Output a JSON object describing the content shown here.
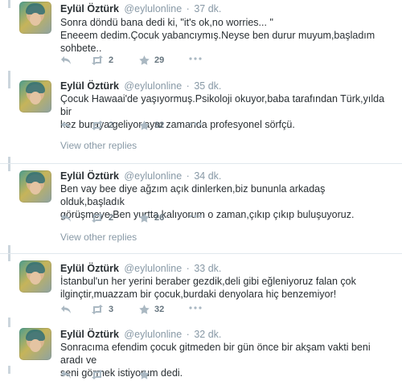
{
  "tweets": [
    {
      "name": "Eylül Öztürk",
      "handle": "@eylulonline",
      "time": "37 dk.",
      "text_lines": [
        "Sonra döndü bana dedi ki, \"it's ok,no worries... \"",
        "Eneeem dedim.Çocuk yabancıymış.Neyse ben durur muyum,başladım",
        "sohbete.."
      ],
      "retweets": "2",
      "favorites": "29"
    },
    {
      "name": "Eylül Öztürk",
      "handle": "@eylulonline",
      "time": "35 dk.",
      "text_lines": [
        "Çocuk Hawaai'de yaşıyormuş.Psikoloji okuyor,baba tarafından Türk,yılda bir",
        "kez buraya geliyor,aynı zamanda profesyonel sörfçü."
      ],
      "retweets": "2",
      "favorites": "32",
      "view_replies": "View other replies"
    },
    {
      "name": "Eylül Öztürk",
      "handle": "@eylulonline",
      "time": "34 dk.",
      "text_lines": [
        "Ben vay bee diye ağzım açık dinlerken,biz bununla arkadaş olduk,başladık",
        "görüşmeye.Ben yurtta kalıyorum o zaman,çıkıp çıkıp buluşuyoruz."
      ],
      "retweets": "2",
      "favorites": "26",
      "view_replies": "View other replies"
    },
    {
      "name": "Eylül Öztürk",
      "handle": "@eylulonline",
      "time": "33 dk.",
      "text_lines": [
        "İstanbul'un her yerini beraber gezdik,deli gibi eğleniyoruz falan çok",
        "ilginçtir,muazzam bir çocuk,burdaki denyolara hiç benzemiyor!"
      ],
      "retweets": "3",
      "favorites": "32"
    },
    {
      "name": "Eylül Öztürk",
      "handle": "@eylulonline",
      "time": "32 dk.",
      "text_lines": [
        "Sonracıma efendim çocuk gitmeden bir gün önce bir akşam vakti beni aradı ve",
        "seni görmek istiyorum dedi."
      ],
      "retweets": "",
      "favorites": ""
    }
  ],
  "colors": {
    "rail": "#ccd6dd",
    "meta": "#8899a6",
    "icon": "#aab8c2",
    "text": "#292f33"
  },
  "icons": {
    "reply": "reply-icon",
    "retweet": "retweet-icon",
    "favorite": "star-icon",
    "more": "more-dots-icon"
  }
}
